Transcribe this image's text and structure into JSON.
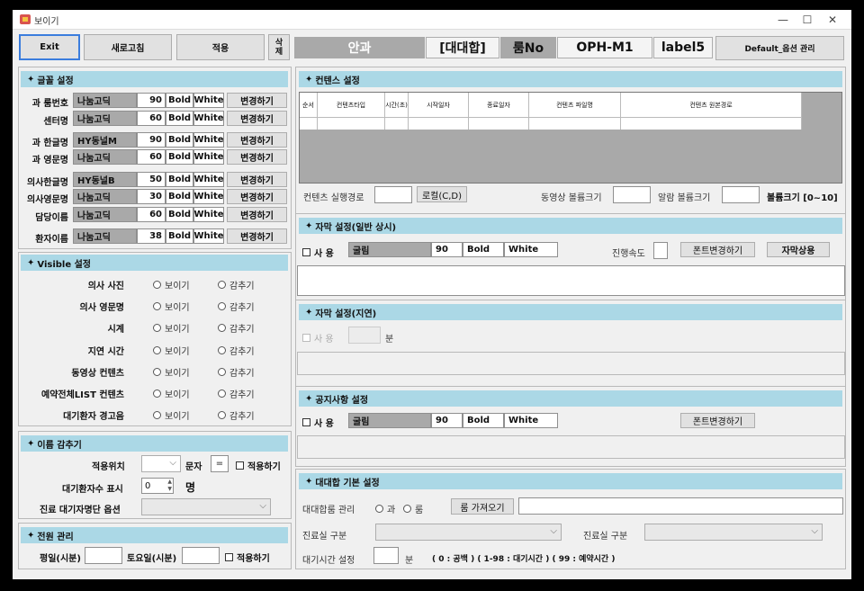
{
  "window": {
    "title": "보이기",
    "min": "—",
    "max": "☐",
    "close": "✕"
  },
  "toolbar": {
    "exit": "Exit",
    "refresh": "새로고침",
    "apply": "적용",
    "delete": "삭제",
    "title": "안과",
    "subtitle": "[대대합]",
    "room_label": "룸No",
    "room_value": "OPH-M1",
    "label5": "label5",
    "options": "Default_옵션 관리"
  },
  "font": {
    "header": "글꼴 설정",
    "rows": [
      {
        "label": "과 룸번호",
        "font": "나눔고딕",
        "size": "90",
        "weight": "Bold",
        "color": "White",
        "btn": "변경하기"
      },
      {
        "label": "센터명",
        "font": "나눔고딕",
        "size": "60",
        "weight": "Bold",
        "color": "White",
        "btn": "변경하기"
      },
      {
        "label": "과 한글명",
        "font": "HY동널M",
        "size": "90",
        "weight": "Bold",
        "color": "White",
        "btn": "변경하기"
      },
      {
        "label": "과 영문명",
        "font": "나눔고딕",
        "size": "60",
        "weight": "Bold",
        "color": "White",
        "btn": "변경하기"
      },
      {
        "label": "의사한글명",
        "font": "HY동널B",
        "size": "50",
        "weight": "Bold",
        "color": "White",
        "btn": "변경하기"
      },
      {
        "label": "의사영문명",
        "font": "나눔고딕",
        "size": "30",
        "weight": "Bold",
        "color": "White",
        "btn": "변경하기"
      },
      {
        "label": "담당이름",
        "font": "나눔고딕",
        "size": "60",
        "weight": "Bold",
        "color": "White",
        "btn": "변경하기"
      },
      {
        "label": "환자이름",
        "font": "나눔고딕",
        "size": "38",
        "weight": "Bold",
        "color": "White",
        "btn": "변경하기"
      }
    ]
  },
  "visible": {
    "header": "Visible 설정",
    "show": "보이기",
    "hide": "감추기",
    "rows": [
      "의사 사진",
      "의사 영문명",
      "시계",
      "지연 시간",
      "동영상 컨텐츠",
      "예약전체LIST 컨텐츠",
      "대기환자 경고음"
    ]
  },
  "hide_name": {
    "header": "이름 감추기",
    "pos_label": "적용위치",
    "char_label": "문자",
    "char_value": "=",
    "apply_chk": "적용하기",
    "count_label": "대기환자수 표시",
    "count_value": "0",
    "count_unit": "명",
    "option_label": "진료 대기자명단 옵션"
  },
  "power": {
    "header": "전원 관리",
    "weekday": "평일(시분)",
    "saturday": "토요일(시분)",
    "apply_chk": "적용하기"
  },
  "content": {
    "header": "컨텐스 설정",
    "columns": [
      "순서",
      "컨텐츠타입",
      "시간(초)",
      "시작일자",
      "종료일자",
      "컨텐츠 파일명",
      "컨텐츠 원본경로"
    ],
    "exec_path": "컨텐츠 실행경로",
    "local_btn": "로컬(C,D)",
    "video_vol": "동영상 볼륨크기",
    "alarm_vol": "알람 볼륨크기",
    "vol_range": "볼륨크기 [0~10]"
  },
  "sub_normal": {
    "header": "자막 설정(일반 상시)",
    "use": "사 용",
    "font": "굴림",
    "size": "90",
    "weight": "Bold",
    "color": "White",
    "speed": "진행속도",
    "font_btn": "폰트변경하기",
    "sub_btn": "자막상용"
  },
  "sub_delay": {
    "header": "자막 설정(지연)",
    "use": "사 용",
    "unit": "분"
  },
  "notice": {
    "header": "공지사항 설정",
    "use": "사 용",
    "font": "굴림",
    "size": "90",
    "weight": "Bold",
    "color": "White",
    "font_btn": "폰트변경하기"
  },
  "basic": {
    "header": "대대합 기본 설정",
    "room_mgmt": "대대합룸 관리",
    "opt_dept": "과",
    "opt_room": "룸",
    "fetch_btn": "룸 가져오기",
    "clinic1": "진료실 구분",
    "clinic2": "진료실 구분",
    "wait_label": "대기시간 설정",
    "wait_unit": "분",
    "wait_help": "( 0 : 공백 ) ( 1-98 : 대기시간 ) ( 99 : 예약시간 )"
  }
}
